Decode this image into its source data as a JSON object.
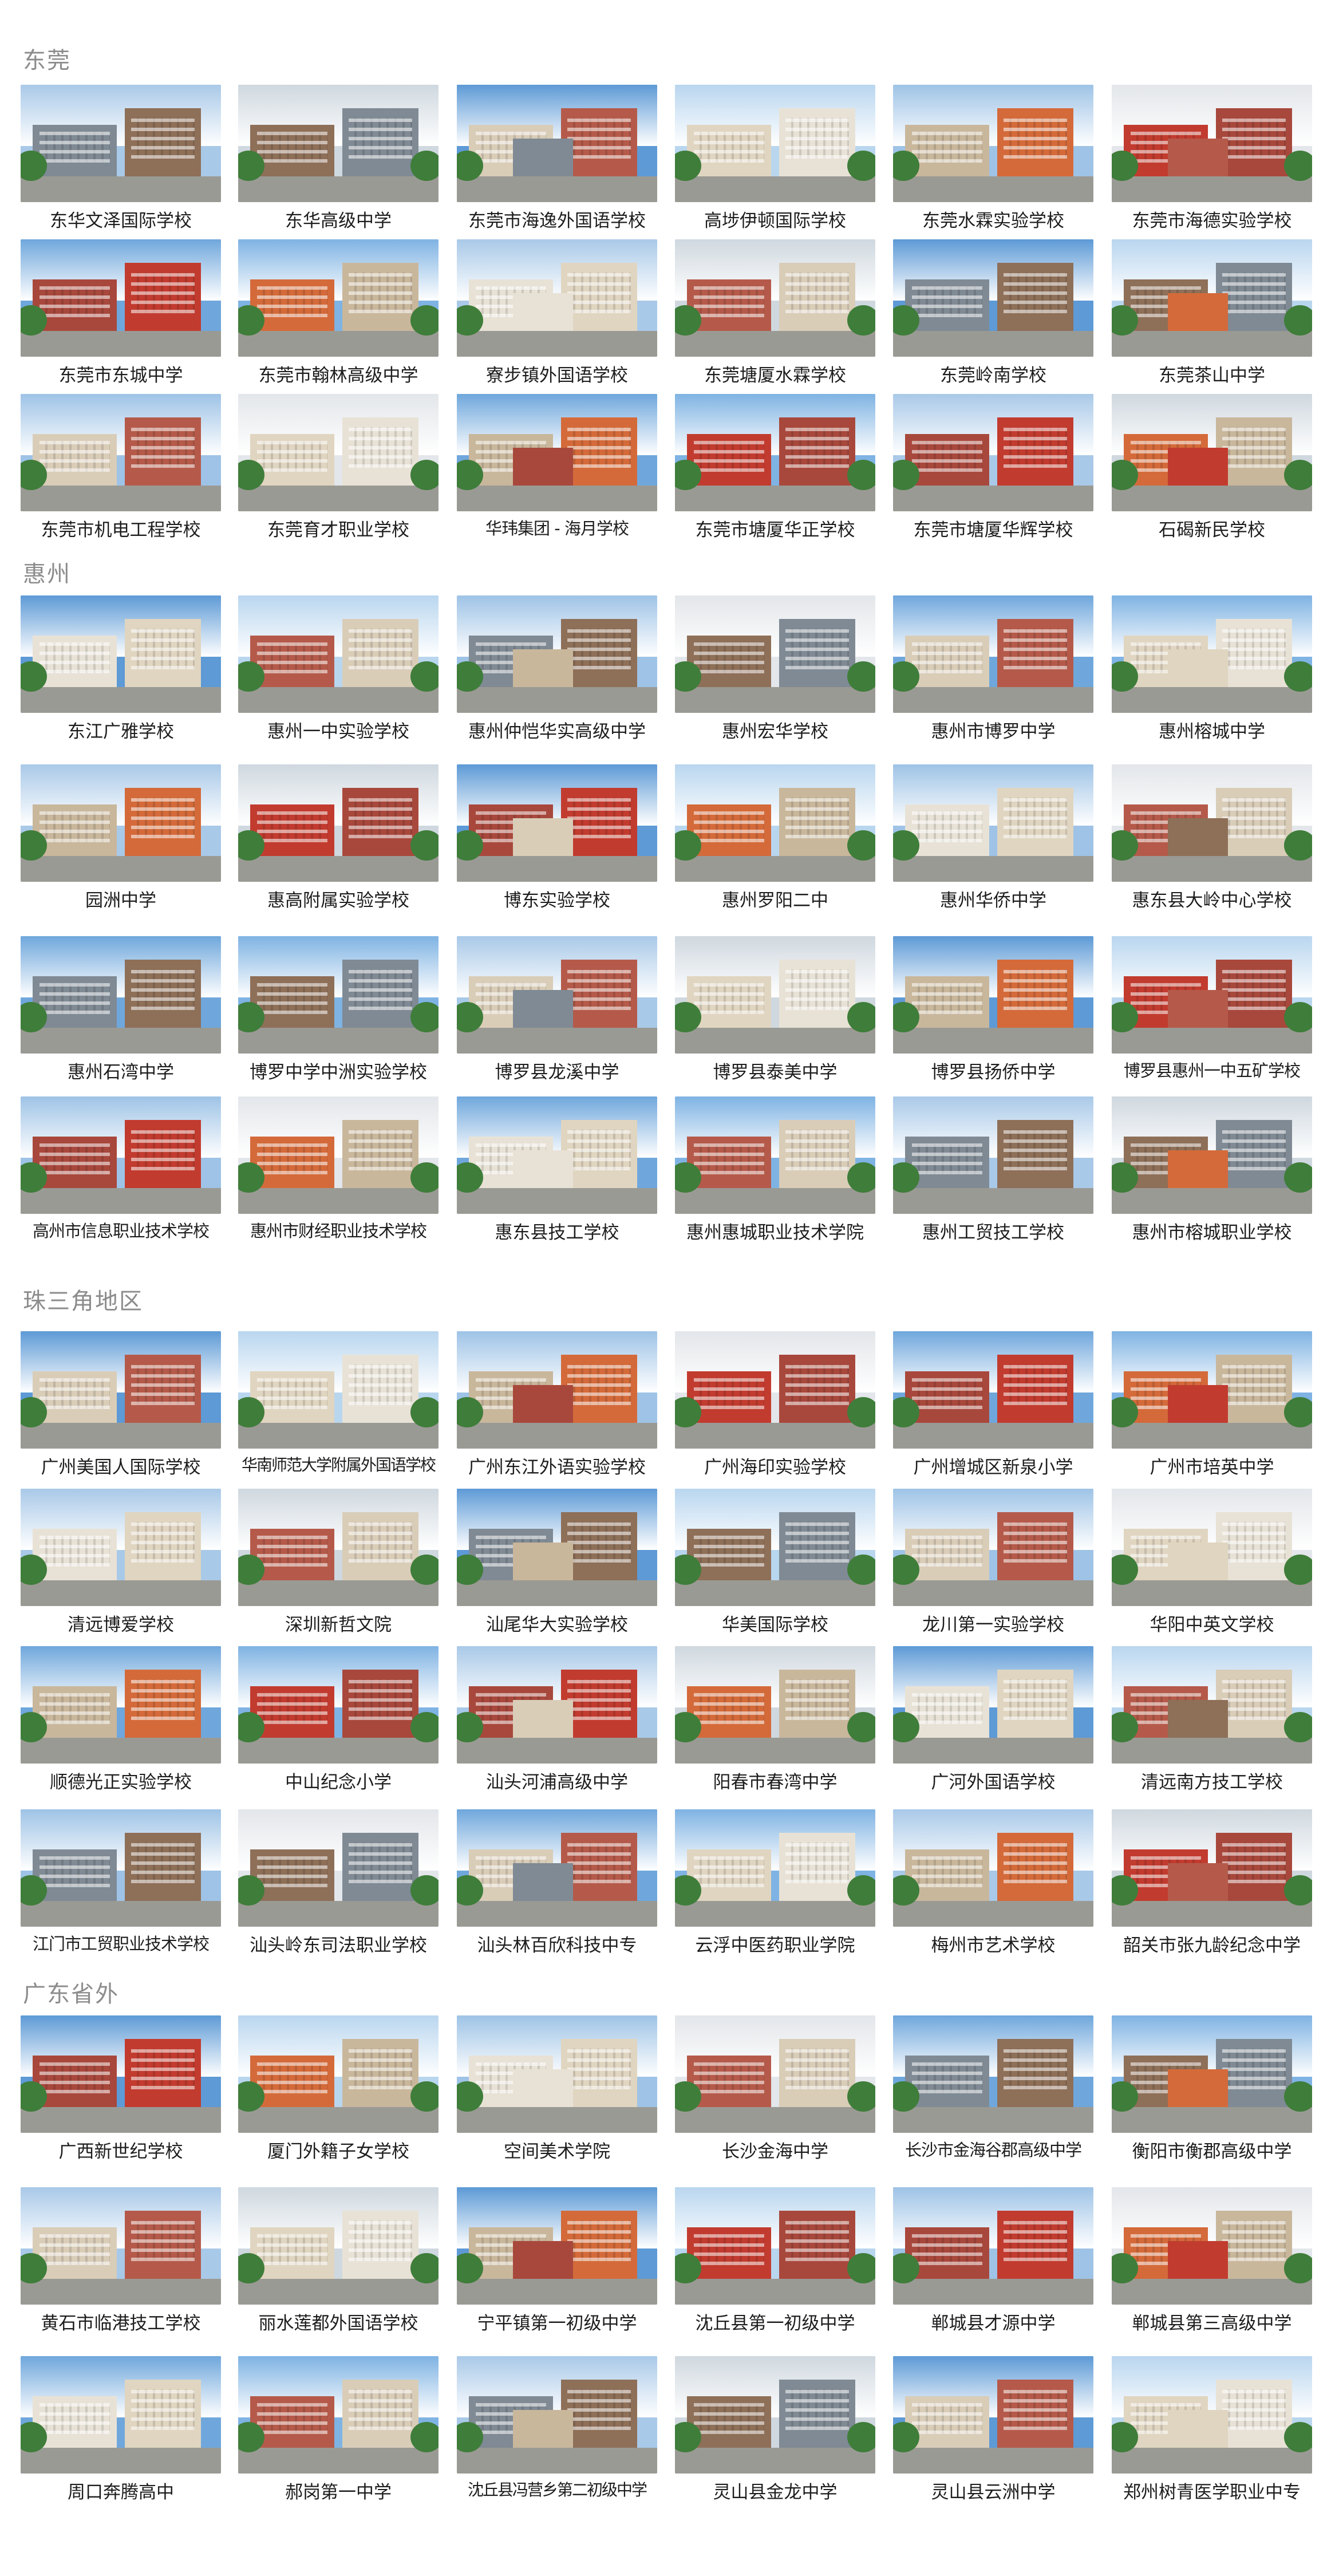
{
  "sections": [
    {
      "title": "东莞",
      "rows": [
        [
          "东华文泽国际学校",
          "东华高级中学",
          "东莞市海逸外国语学校",
          "高埗伊顿国际学校",
          "东莞水霖实验学校",
          "东莞市海德实验学校"
        ],
        [
          "东莞市东城中学",
          "东莞市翰林高级中学",
          "寮步镇外国语学校",
          "东莞塘厦水霖学校",
          "东莞岭南学校",
          "东莞茶山中学"
        ],
        [
          "东莞市机电工程学校",
          "东莞育才职业学校",
          "华玮集团 - 海月学校",
          "东莞市塘厦华正学校",
          "东莞市塘厦华辉学校",
          "石碣新民学校"
        ]
      ]
    },
    {
      "title": "惠州",
      "rows": [
        [
          "东江广雅学校",
          "惠州一中实验学校",
          "惠州仲恺华实高级中学",
          "惠州宏华学校",
          "惠州市博罗中学",
          "惠州榕城中学"
        ],
        [
          "园洲中学",
          "惠高附属实验学校",
          "博东实验学校",
          "惠州罗阳二中",
          "惠州华侨中学",
          "惠东县大岭中心学校"
        ],
        [
          "惠州石湾中学",
          "博罗中学中洲实验学校",
          "博罗县龙溪中学",
          "博罗县泰美中学",
          "博罗县扬侨中学",
          "博罗县惠州一中五矿学校"
        ],
        [
          "高州市信息职业技术学校",
          "惠州市财经职业技术学校",
          "惠东县技工学校",
          "惠州惠城职业技术学院",
          "惠州工贸技工学校",
          "惠州市榕城职业学校"
        ]
      ]
    },
    {
      "title": "珠三角地区",
      "rows": [
        [
          "广州美国人国际学校",
          "华南师范大学附属外国语学校",
          "广州东江外语实验学校",
          "广州海印实验学校",
          "广州增城区新泉小学",
          "广州市培英中学"
        ],
        [
          "清远博爱学校",
          "深圳新哲文院",
          "汕尾华大实验学校",
          "华美国际学校",
          "龙川第一实验学校",
          "华阳中英文学校"
        ],
        [
          "顺德光正实验学校",
          "中山纪念小学",
          "汕头河浦高级中学",
          "阳春市春湾中学",
          "广河外国语学校",
          "清远南方技工学校"
        ],
        [
          "江门市工贸职业技术学校",
          "汕头岭东司法职业学校",
          "汕头林百欣科技中专",
          "云浮中医药职业学院",
          "梅州市艺术学校",
          "韶关市张九龄纪念中学"
        ]
      ]
    },
    {
      "title": "广东省外",
      "rows": [
        [
          "广西新世纪学校",
          "厦门外籍子女学校",
          "空间美术学院",
          "长沙金海中学",
          "长沙市金海谷郡高级中学",
          "衡阳市衡郡高级中学"
        ],
        [
          "黄石市临港技工学校",
          "丽水莲都外国语学校",
          "宁平镇第一初级中学",
          "沈丘县第一初级中学",
          "郸城县才源中学",
          "郸城县第三高级中学"
        ],
        [
          "周口奔腾高中",
          "郝岗第一中学",
          "沈丘县冯营乡第二初级中学",
          "灵山县金龙中学",
          "灵山县云洲中学",
          "郑州树青医学职业中专"
        ]
      ]
    }
  ],
  "palette": {
    "skies": [
      "#7fb3e3",
      "#a9c9e8",
      "#cfd8df",
      "#5d9ad6",
      "#b9d6ef",
      "#9ec3e6",
      "#e3e6ea",
      "#6fa7dc"
    ],
    "buildings": [
      "#b55a4a",
      "#d9cdb8",
      "#c23b2f",
      "#e8e2d6",
      "#8e6f58",
      "#c9b79c",
      "#d46a3a",
      "#7f8a94",
      "#e0d5c0",
      "#a8483c"
    ]
  }
}
